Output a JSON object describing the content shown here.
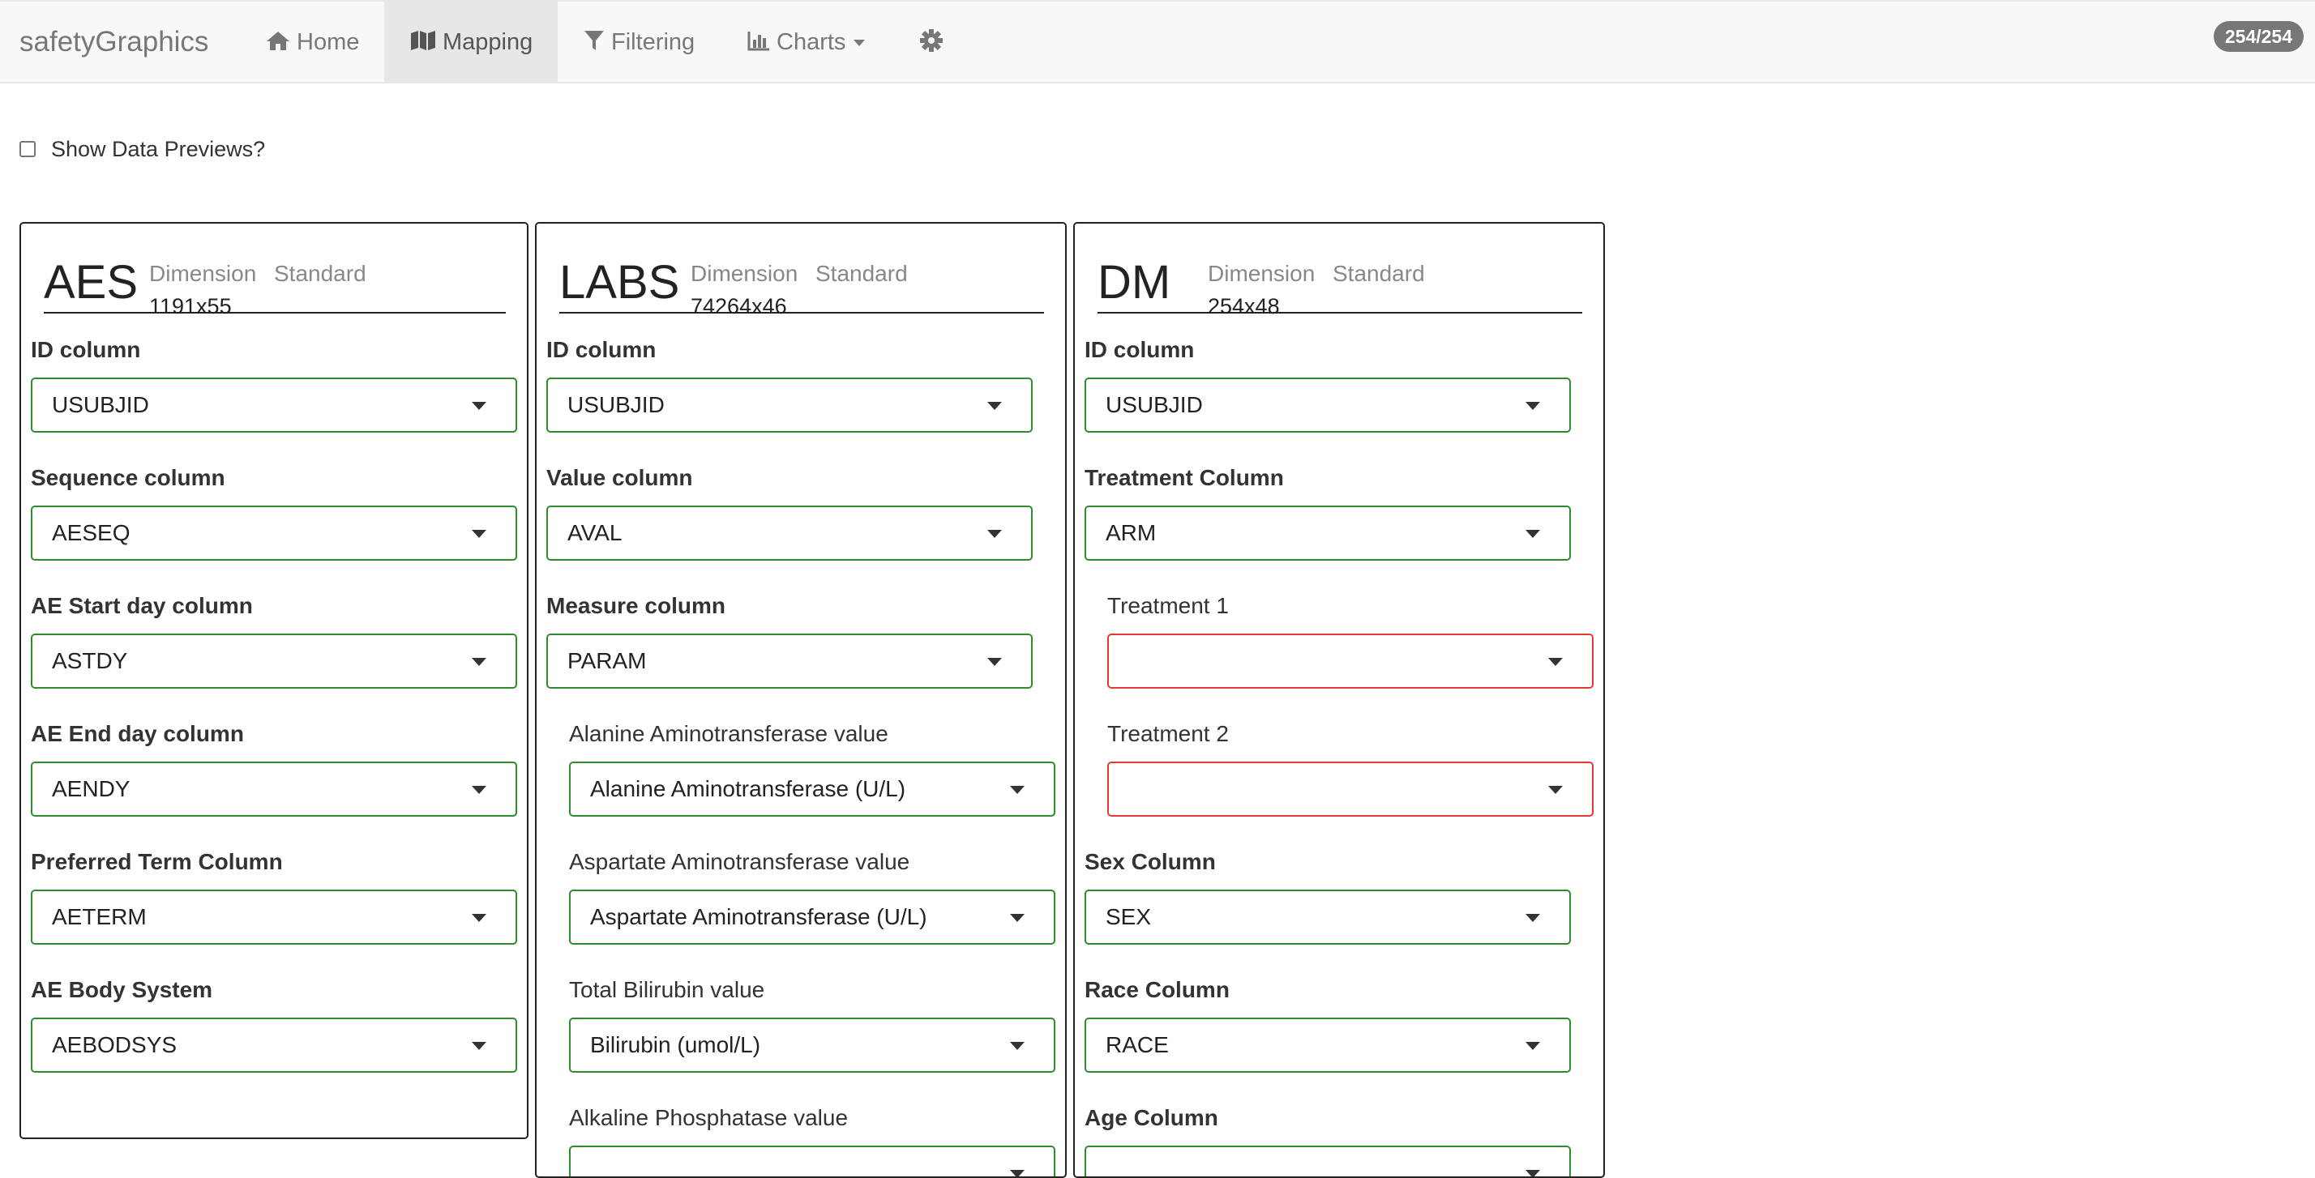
{
  "navbar": {
    "brand": "safetyGraphics",
    "items": [
      {
        "label": "Home",
        "icon": "home-icon"
      },
      {
        "label": "Mapping",
        "icon": "map-icon",
        "active": true
      },
      {
        "label": "Filtering",
        "icon": "filter-icon"
      },
      {
        "label": "Charts",
        "icon": "bar-chart-icon"
      },
      {
        "label": "",
        "icon": "gear-icon"
      }
    ],
    "badge": "254/254"
  },
  "preview": {
    "label": "Show Data Previews?",
    "checked": false
  },
  "panels": {
    "aes": {
      "title": "AES",
      "dim_label": "Dimension",
      "std_label": "Standard",
      "dim_value": "1191x55",
      "fields": [
        {
          "label": "ID column",
          "value": "USUBJID"
        },
        {
          "label": "Sequence column",
          "value": "AESEQ"
        },
        {
          "label": "AE Start day column",
          "value": "ASTDY"
        },
        {
          "label": "AE End day column",
          "value": "AENDY"
        },
        {
          "label": "Preferred Term Column",
          "value": "AETERM"
        },
        {
          "label": "AE Body System",
          "value": "AEBODSYS"
        }
      ]
    },
    "labs": {
      "title": "LABS",
      "dim_label": "Dimension",
      "std_label": "Standard",
      "dim_value": "74264x46",
      "fields": [
        {
          "label": "ID column",
          "value": "USUBJID"
        },
        {
          "label": "Value column",
          "value": "AVAL"
        },
        {
          "label": "Measure column",
          "value": "PARAM"
        },
        {
          "label": "Alanine Aminotransferase value",
          "value": "Alanine Aminotransferase (U/L)"
        },
        {
          "label": "Aspartate Aminotransferase value",
          "value": "Aspartate Aminotransferase (U/L)"
        },
        {
          "label": "Total Bilirubin value",
          "value": "Bilirubin (umol/L)"
        },
        {
          "label": "Alkaline Phosphatase value",
          "value": ""
        }
      ]
    },
    "dm": {
      "title": "DM",
      "dim_label": "Dimension",
      "std_label": "Standard",
      "dim_value": "254x48",
      "fields": [
        {
          "label": "ID column",
          "value": "USUBJID"
        },
        {
          "label": "Treatment Column",
          "value": "ARM"
        },
        {
          "label": "Treatment 1",
          "value": ""
        },
        {
          "label": "Treatment 2",
          "value": ""
        },
        {
          "label": "Sex Column",
          "value": "SEX"
        },
        {
          "label": "Race Column",
          "value": "RACE"
        },
        {
          "label": "Age Column",
          "value": ""
        }
      ]
    }
  },
  "colors": {
    "valid": "#2e8b2e",
    "invalid": "#e53935",
    "navbar_bg": "#f8f8f8",
    "badge_bg": "#777777"
  }
}
